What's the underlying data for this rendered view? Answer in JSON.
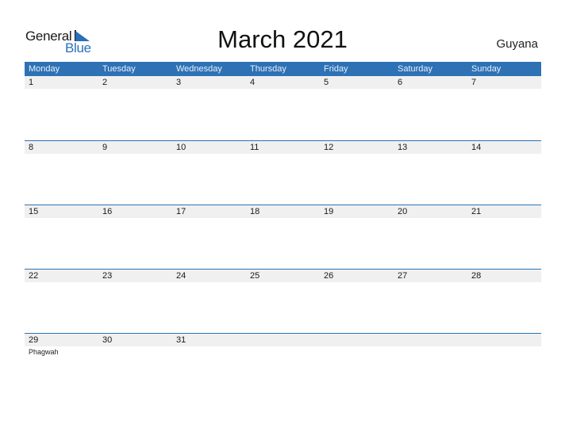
{
  "logo": {
    "word1": "General",
    "word2": "Blue"
  },
  "title": "March 2021",
  "country": "Guyana",
  "colors": {
    "accent": "#2e71b5",
    "date_row_bg": "#f0f0f0"
  },
  "weekdays": [
    "Monday",
    "Tuesday",
    "Wednesday",
    "Thursday",
    "Friday",
    "Saturday",
    "Sunday"
  ],
  "weeks": [
    {
      "dates": [
        "1",
        "2",
        "3",
        "4",
        "5",
        "6",
        "7"
      ],
      "events": [
        "",
        "",
        "",
        "",
        "",
        "",
        ""
      ]
    },
    {
      "dates": [
        "8",
        "9",
        "10",
        "11",
        "12",
        "13",
        "14"
      ],
      "events": [
        "",
        "",
        "",
        "",
        "",
        "",
        ""
      ]
    },
    {
      "dates": [
        "15",
        "16",
        "17",
        "18",
        "19",
        "20",
        "21"
      ],
      "events": [
        "",
        "",
        "",
        "",
        "",
        "",
        ""
      ]
    },
    {
      "dates": [
        "22",
        "23",
        "24",
        "25",
        "26",
        "27",
        "28"
      ],
      "events": [
        "",
        "",
        "",
        "",
        "",
        "",
        ""
      ]
    },
    {
      "dates": [
        "29",
        "30",
        "31",
        "",
        "",
        "",
        ""
      ],
      "events": [
        "Phagwah",
        "",
        "",
        "",
        "",
        "",
        ""
      ]
    }
  ]
}
